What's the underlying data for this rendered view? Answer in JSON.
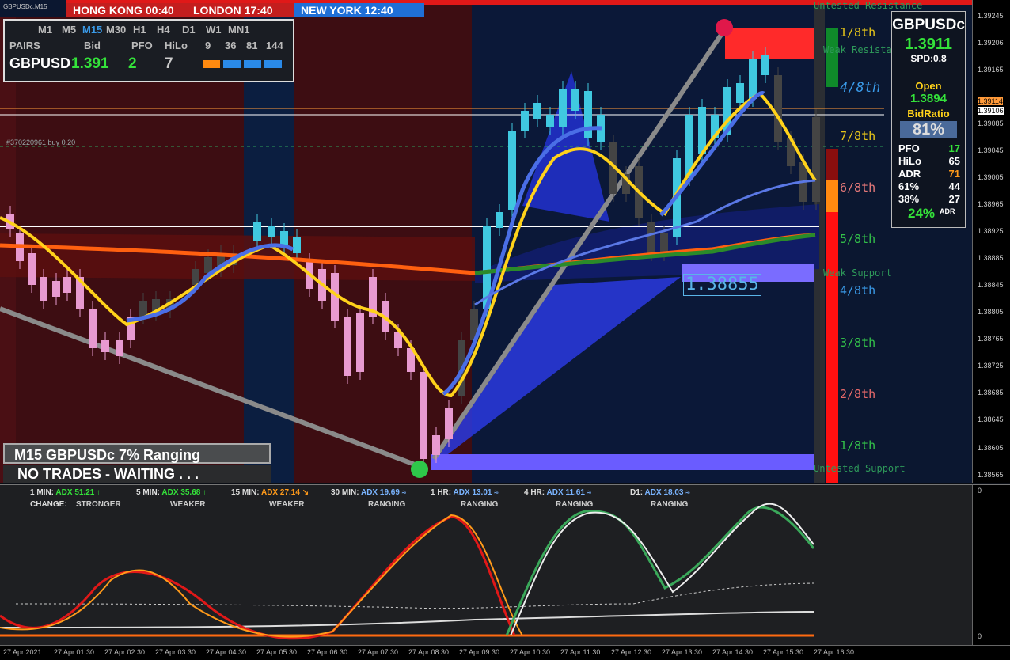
{
  "chart_symbol": "GBPUSDc,M15",
  "sessions": [
    {
      "city": "HONG KONG",
      "time": "00:40",
      "bg": "#c41e1e"
    },
    {
      "city": "LONDON",
      "time": "17:40",
      "bg": "#c41e1e"
    },
    {
      "city": "NEW YORK",
      "time": "12:40",
      "bg": "#1f6fd6"
    }
  ],
  "timeframes": [
    "M1",
    "M5",
    "M15",
    "M30",
    "H1",
    "H4",
    "D1",
    "W1",
    "MN1"
  ],
  "active_timeframe": "M15",
  "pairs_panel": {
    "pairs_label": "PAIRS",
    "bid_label": "Bid",
    "pfo_label": "PFO",
    "hilo_label": "HiLo",
    "periods": [
      "9",
      "36",
      "81",
      "144"
    ],
    "pair": "GBPUSD",
    "bid": "1.391",
    "pfo": "2",
    "hilo": "7"
  },
  "order_label": "#370220961 buy 0.20",
  "right_panel": {
    "symbol": "GBPUSDc",
    "price": "1.3911",
    "spread": "SPD:0.8",
    "open_label": "Open",
    "open_value": "1.3894",
    "bidratio_label": "BidRatio",
    "bidratio_value": "81%",
    "rows": [
      {
        "k": "PFO",
        "v": "17",
        "c": "#34e23a"
      },
      {
        "k": "HiLo",
        "v": "65",
        "c": "#ffffff"
      },
      {
        "k": "ADR",
        "v": "71",
        "c": "#ff9a1a"
      },
      {
        "k": "61%",
        "v": "44",
        "c": "#ffffff"
      },
      {
        "k": "38%",
        "v": "27",
        "c": "#ffffff"
      }
    ],
    "adr_pct": "24%",
    "adr_label": "ADR"
  },
  "fib_levels": [
    {
      "label": "1/8th",
      "color": "#e8c619"
    },
    {
      "label": "4/8th",
      "color": "#3a9ae8"
    },
    {
      "label": "7/8th",
      "color": "#e8c619"
    },
    {
      "label": "6/8th",
      "color": "#e87a7a"
    },
    {
      "label": "5/8th",
      "color": "#33c24a"
    },
    {
      "label": "4/8th",
      "color": "#3a9ae8"
    },
    {
      "label": "3/8th",
      "color": "#33c24a"
    },
    {
      "label": "2/8th",
      "color": "#e86a6a"
    },
    {
      "label": "1/8th",
      "color": "#33c24a"
    }
  ],
  "levels": {
    "untested_resistance": "Untested Resistance",
    "weak_resistance": "Weak Resistance",
    "weak_support": "Weak Support",
    "untested_support": "Untested Support"
  },
  "price_box": "1.38855",
  "price_axis": [
    "1.39245",
    "1.39206",
    "1.39165",
    "1.39114",
    "1.39106",
    "1.39085",
    "1.39045",
    "1.39005",
    "1.38965",
    "1.38925",
    "1.38885",
    "1.38845",
    "1.38805",
    "1.38765",
    "1.38725",
    "1.38685",
    "1.38645",
    "1.38605",
    "1.38565"
  ],
  "status_line1": "M15 GBPUSDc  7% Ranging",
  "status_line2": "NO TRADES - WAITING . . .",
  "adx": [
    {
      "tf": "1 MIN:",
      "val": "ADX 51.21",
      "arrow": "↑",
      "color": "#34e23a",
      "state": "STRONGER"
    },
    {
      "tf": "5 MIN:",
      "val": "ADX 35.68",
      "arrow": "↑",
      "color": "#34e23a",
      "state": "WEAKER"
    },
    {
      "tf": "15 MIN:",
      "val": "ADX 27.14",
      "arrow": "↘",
      "color": "#ff9a1a",
      "state": "WEAKER"
    },
    {
      "tf": "30 MIN:",
      "val": "ADX 19.69",
      "arrow": "≈",
      "color": "#7ab4ff",
      "state": "RANGING"
    },
    {
      "tf": "1 HR:",
      "val": "ADX 13.01",
      "arrow": "≈",
      "color": "#7ab4ff",
      "state": "RANGING"
    },
    {
      "tf": "4 HR:",
      "val": "ADX 11.61",
      "arrow": "≈",
      "color": "#7ab4ff",
      "state": "RANGING"
    },
    {
      "tf": "D1:",
      "val": "ADX 18.03",
      "arrow": "≈",
      "color": "#7ab4ff",
      "state": "RANGING"
    }
  ],
  "change_label": "CHANGE:",
  "ind_axis_top": "0",
  "ind_axis_bottom": "0",
  "time_axis": [
    "27 Apr 2021",
    "27 Apr 01:30",
    "27 Apr 02:30",
    "27 Apr 03:30",
    "27 Apr 04:30",
    "27 Apr 05:30",
    "27 Apr 06:30",
    "27 Apr 07:30",
    "27 Apr 08:30",
    "27 Apr 09:30",
    "27 Apr 10:30",
    "27 Apr 11:30",
    "27 Apr 12:30",
    "27 Apr 13:30",
    "27 Apr 14:30",
    "27 Apr 15:30",
    "27 Apr 16:30"
  ]
}
